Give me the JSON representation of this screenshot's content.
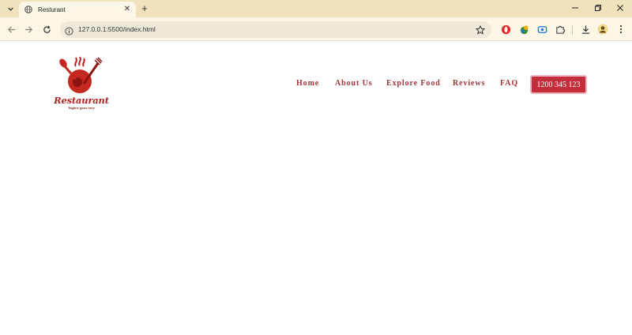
{
  "browser": {
    "tab": {
      "title": "Resturant",
      "favicon": "globe-icon"
    },
    "url": "127.0.0.1:5500/index.html",
    "accent": "#efe2bd"
  },
  "site": {
    "logo": {
      "wordmark": "Restaurant",
      "tagline": "Tagline goes here"
    },
    "nav": [
      "Home",
      "About Us",
      "Explore Food",
      "Reviews",
      "FAQ"
    ],
    "phone": "1200 345 123",
    "brand_color": "#c32d3c"
  }
}
